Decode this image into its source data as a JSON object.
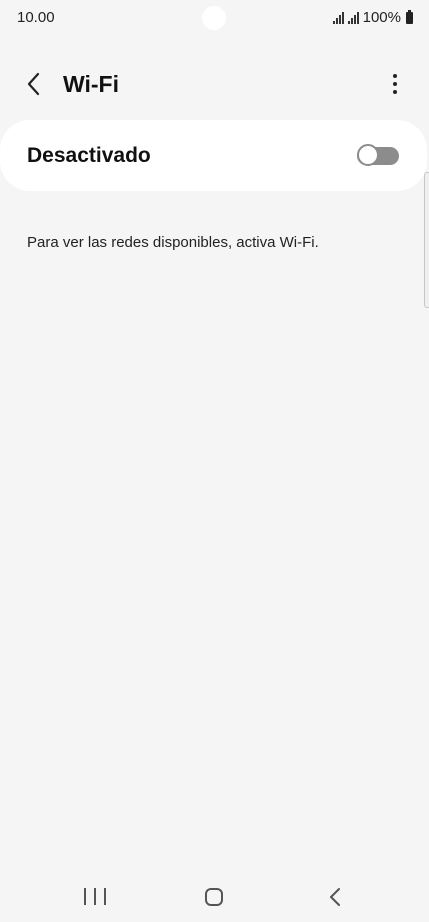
{
  "status_bar": {
    "time": "10.00",
    "battery_text": "100%",
    "icons": [
      "signal-icon",
      "signal-icon",
      "battery-icon"
    ]
  },
  "app_bar": {
    "title": "Wi-Fi",
    "back_icon": "chevron-left-icon",
    "more_icon": "more-vertical-icon"
  },
  "wifi_toggle": {
    "label": "Desactivado",
    "state": "off"
  },
  "help": {
    "text": "Para ver las redes disponibles, activa Wi-Fi."
  },
  "nav_bar": {
    "icons": [
      "recents-icon",
      "home-icon",
      "back-icon"
    ]
  },
  "colors": {
    "background": "#f5f5f5",
    "card": "#ffffff",
    "switch_off": "#8c8c8c"
  }
}
